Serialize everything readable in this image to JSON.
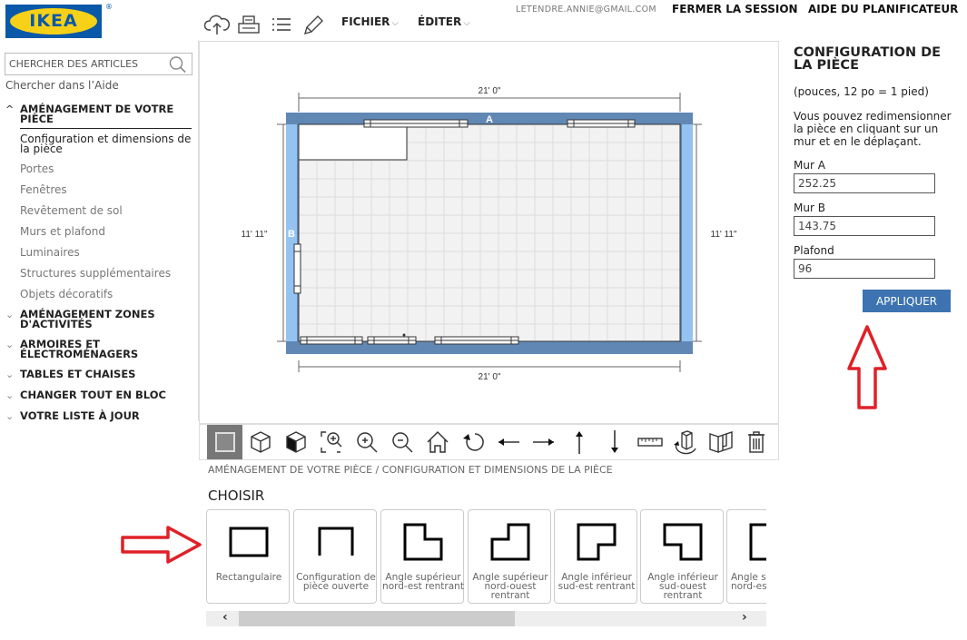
{
  "brand": {
    "logo_text": "IKEA",
    "registered": "®",
    "colors": {
      "blue": "#0a58a8",
      "yellow": "#f7d117"
    }
  },
  "search": {
    "placeholder": "CHERCHER DES ARTICLES",
    "value": "",
    "icon": "search-icon"
  },
  "help_search_link": "Chercher dans l’Aide",
  "header": {
    "icons": [
      "cloud-upload-icon",
      "print-icon",
      "list-icon",
      "pencil-icon"
    ],
    "menus": [
      {
        "label": "FICHIER",
        "caret": "⌵"
      },
      {
        "label": "ÉDITER",
        "caret": "⌵"
      }
    ],
    "user_email": "LETENDRE.ANNIE@GMAIL.COM",
    "logout": "FERMER LA SESSION",
    "planner_help": "AIDE DU PLANIFICATEUR"
  },
  "sidebar": {
    "open_section": {
      "title_line1": "AMÉNAGEMENT DE VOTRE",
      "title_line2": "PIÈCE",
      "chevron": "^",
      "items": [
        {
          "label_line1": "Configuration et dimensions de",
          "label_line2": "la pièce",
          "active": true
        },
        {
          "label": "Portes"
        },
        {
          "label": "Fenêtres"
        },
        {
          "label": "Revêtement de sol"
        },
        {
          "label": "Murs et plafond"
        },
        {
          "label": "Luminaires"
        },
        {
          "label": "Structures supplémentaires"
        },
        {
          "label": "Objets décoratifs"
        }
      ]
    },
    "collapsed_sections": [
      {
        "line1": "AMÉNAGEMENT ZONES",
        "line2": "D'ACTIVITÉS",
        "chevron": "⌄"
      },
      {
        "line1": "ARMOIRES ET",
        "line2": "ÉLECTROMÉNAGERS",
        "chevron": "⌄"
      },
      {
        "line1": "TABLES ET CHAISES",
        "line2": "",
        "chevron": "⌄"
      },
      {
        "line1": "CHANGER TOUT EN BLOC",
        "line2": "",
        "chevron": "⌄"
      },
      {
        "line1": "VOTRE LISTE À JOUR",
        "line2": "",
        "chevron": "⌄"
      }
    ]
  },
  "floorplan": {
    "dimension_top": "21' 0\"",
    "dimension_bottom": "21' 0\"",
    "dimension_left": "11' 11\"",
    "dimension_right": "11' 11\"",
    "wall_a_label": "A",
    "wall_b_label": "B",
    "colors": {
      "wall_horizontal": "#6188b4",
      "wall_vertical": "#94c3f2",
      "floor": "#f2f2f2",
      "grid": "#dcdcdc"
    }
  },
  "toolbar": {
    "tools": [
      {
        "name": "2d-view-icon",
        "active": true
      },
      {
        "name": "3d-view-icon"
      },
      {
        "name": "3d-solid-view-icon"
      },
      {
        "name": "zoom-fit-icon"
      },
      {
        "name": "zoom-in-icon"
      },
      {
        "name": "zoom-out-icon"
      },
      {
        "name": "home-icon"
      },
      {
        "name": "rotate-icon"
      },
      {
        "name": "arrow-left-icon"
      },
      {
        "name": "arrow-right-icon"
      },
      {
        "name": "arrow-up-icon"
      },
      {
        "name": "arrow-down-icon"
      },
      {
        "name": "ruler-icon"
      },
      {
        "name": "rotate-object-icon"
      },
      {
        "name": "wall-view-icon"
      },
      {
        "name": "trash-icon"
      }
    ]
  },
  "breadcrumb": "AMÉNAGEMENT DE VOTRE PIÈCE / CONFIGURATION ET DIMENSIONS DE LA PIÈCE",
  "choose": {
    "title": "CHOISIR",
    "shapes": [
      {
        "line1": "Rectangulaire",
        "line2": "",
        "line3": ""
      },
      {
        "line1": "Configuration de",
        "line2": "pièce ouverte",
        "line3": ""
      },
      {
        "line1": "Angle supérieur",
        "line2": "nord-est rentrant",
        "line3": ""
      },
      {
        "line1": "Angle supérieur",
        "line2": "nord-ouest",
        "line3": "rentrant"
      },
      {
        "line1": "Angle inférieur",
        "line2": "sud-est rentrant",
        "line3": ""
      },
      {
        "line1": "Angle inférieur",
        "line2": "sud-ouest",
        "line3": "rentrant"
      },
      {
        "line1": "Angle s",
        "line2": "nord-es",
        "line3": ""
      }
    ],
    "scroll_left": "‹",
    "scroll_right": "›"
  },
  "room_config": {
    "title_line1": "CONFIGURATION DE",
    "title_line2": "LA PIÈCE",
    "units_note": "(pouces, 12 po = 1 pied)",
    "description": "Vous pouvez redimensionner la pièce en cliquant sur un mur et en le déplaçant.",
    "fields": [
      {
        "label": "Mur A",
        "value": "252.25"
      },
      {
        "label": "Mur B",
        "value": "143.75"
      },
      {
        "label": "Plafond",
        "value": "96"
      }
    ],
    "apply_label": "APPLIQUER",
    "apply_color": "#3d73b0"
  },
  "annotations": {
    "arrow_color": "#e02027"
  }
}
